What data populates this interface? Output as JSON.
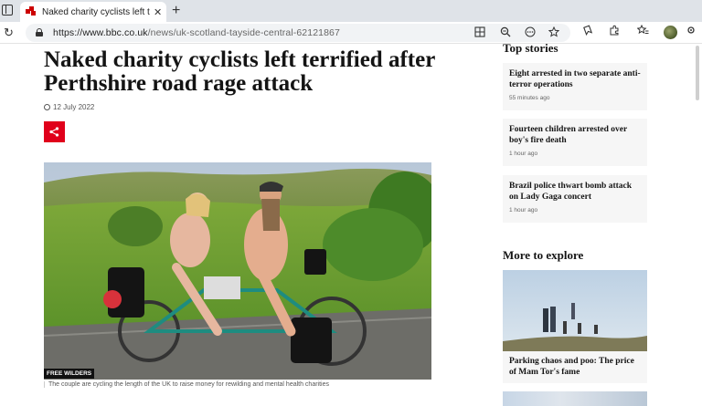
{
  "browser": {
    "tab_title": "Naked charity cyclists left terrified",
    "tab_close": "✕",
    "new_tab": "+",
    "reload": "↻",
    "url_host": "https://www.bbc.co.uk",
    "url_path": "/news/uk-scotland-tayside-central-62121867",
    "icons": [
      "reader-view-icon",
      "zoom-icon",
      "more-icon",
      "favorite-star-icon",
      "collections-icon",
      "extensions-icon",
      "favorites-icon",
      "profile-avatar"
    ]
  },
  "article": {
    "headline": "Naked charity cyclists left terrified after Perthshire road rage attack",
    "date": "12 July 2022",
    "photo_credit": "FREE WILDERS",
    "caption": "The couple are cycling the length of the UK to raise money for rewilding and mental health charities"
  },
  "sidebar": {
    "top_stories_title": "Top stories",
    "stories": [
      {
        "title": "Eight arrested in two separate anti-terror operations",
        "time": "55 minutes ago"
      },
      {
        "title": "Fourteen children arrested over boy's fire death",
        "time": "1 hour ago"
      },
      {
        "title": "Brazil police thwart bomb attack on Lady Gaga concert",
        "time": "1 hour ago"
      }
    ],
    "more_title": "More to explore",
    "explore": [
      {
        "title": "Parking chaos and poo: The price of Mam Tor's fame"
      }
    ]
  },
  "colors": {
    "bbc_red": "#e0001b",
    "tab_bar": "#dfe3e8",
    "card_bg": "#f6f6f6"
  }
}
